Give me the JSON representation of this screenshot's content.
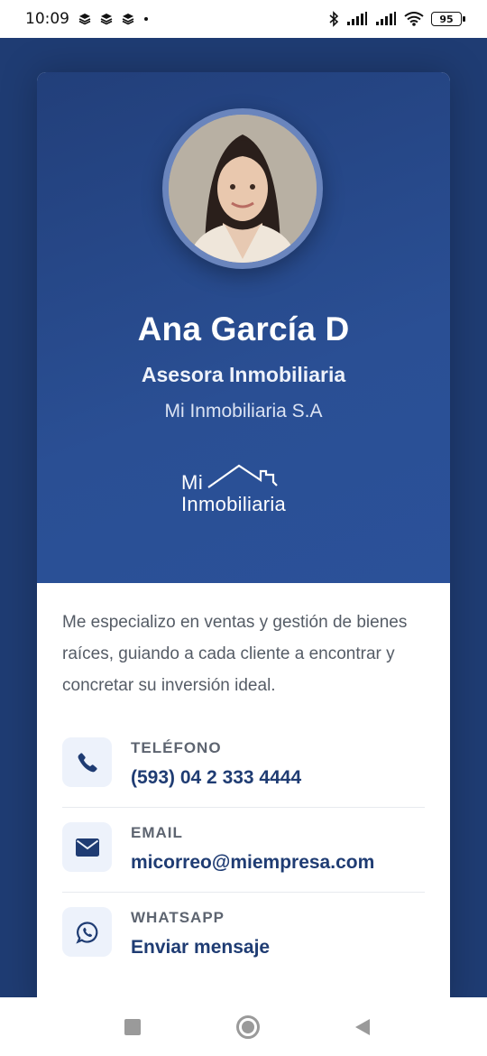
{
  "status_bar": {
    "time": "10:09",
    "battery": "95",
    "icons": [
      "layers-icon",
      "layers-icon",
      "layers-icon",
      "dot-icon",
      "bluetooth-icon",
      "signal-icon",
      "signal-icon",
      "wifi-icon",
      "battery-icon"
    ]
  },
  "profile": {
    "name": "Ana García D",
    "role": "Asesora Inmobiliaria",
    "company": "Mi Inmobiliaria S.A",
    "logo_line1": "Mi",
    "logo_line2": "Inmobiliaria"
  },
  "bio": "Me especializo en ventas y gestión de bienes raíces, guiando a cada cliente a encontrar y concretar su inversión ideal.",
  "contacts": [
    {
      "icon": "phone-icon",
      "label": "TELÉFONO",
      "value": "(593) 04 2 333 4444"
    },
    {
      "icon": "envelope-icon",
      "label": "EMAIL",
      "value": "micorreo@miempresa.com"
    },
    {
      "icon": "whatsapp-icon",
      "label": "WHATSAPP",
      "value": "Enviar mensaje"
    }
  ],
  "colors": {
    "brand_dark": "#1f3c73",
    "brand": "#2a4f94",
    "icon_bg": "#edf2fb"
  }
}
